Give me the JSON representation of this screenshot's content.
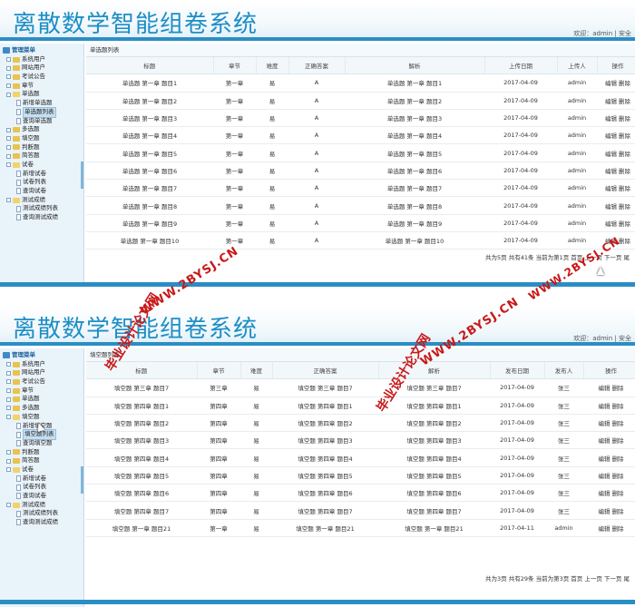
{
  "panel1": {
    "app_title": "离散数学智能组卷系统",
    "welcome": "欢迎：admin | 安全",
    "sidebar": [
      {
        "label": "管理菜单",
        "level": 0,
        "kind": "root"
      },
      {
        "label": "系统用户",
        "level": 1,
        "kind": "folder"
      },
      {
        "label": "网站用户",
        "level": 1,
        "kind": "folder"
      },
      {
        "label": "考试公告",
        "level": 1,
        "kind": "folder"
      },
      {
        "label": "章节",
        "level": 1,
        "kind": "folder"
      },
      {
        "label": "单选题",
        "level": 1,
        "kind": "folder-open"
      },
      {
        "label": "新增单选题",
        "level": 2,
        "kind": "page"
      },
      {
        "label": "单选题列表",
        "level": 2,
        "kind": "page",
        "selected": true
      },
      {
        "label": "查询单选题",
        "level": 2,
        "kind": "page"
      },
      {
        "label": "多选题",
        "level": 1,
        "kind": "folder"
      },
      {
        "label": "填空题",
        "level": 1,
        "kind": "folder"
      },
      {
        "label": "判断题",
        "level": 1,
        "kind": "folder"
      },
      {
        "label": "简答题",
        "level": 1,
        "kind": "folder"
      },
      {
        "label": "试卷",
        "level": 1,
        "kind": "folder-open"
      },
      {
        "label": "新增试卷",
        "level": 2,
        "kind": "page"
      },
      {
        "label": "试卷列表",
        "level": 2,
        "kind": "page"
      },
      {
        "label": "查询试卷",
        "level": 2,
        "kind": "page"
      },
      {
        "label": "测试成绩",
        "level": 1,
        "kind": "folder-open"
      },
      {
        "label": "测试成绩列表",
        "level": 2,
        "kind": "page"
      },
      {
        "label": "查询测试成绩",
        "level": 2,
        "kind": "page"
      }
    ],
    "list_title": "单选题列表",
    "columns": [
      "标题",
      "章节",
      "难度",
      "正确答案",
      "解析",
      "上传日期",
      "上传人",
      "操作"
    ],
    "rows": [
      [
        "单选题 第一章 题目1",
        "第一章",
        "易",
        "A",
        "单选题 第一章 题目1",
        "2017-04-09",
        "admin"
      ],
      [
        "单选题 第一章 题目2",
        "第一章",
        "易",
        "A",
        "单选题 第一章 题目2",
        "2017-04-09",
        "admin"
      ],
      [
        "单选题 第一章 题目3",
        "第一章",
        "易",
        "A",
        "单选题 第一章 题目3",
        "2017-04-09",
        "admin"
      ],
      [
        "单选题 第一章 题目4",
        "第一章",
        "易",
        "A",
        "单选题 第一章 题目4",
        "2017-04-09",
        "admin"
      ],
      [
        "单选题 第一章 题目5",
        "第一章",
        "易",
        "A",
        "单选题 第一章 题目5",
        "2017-04-09",
        "admin"
      ],
      [
        "单选题 第一章 题目6",
        "第一章",
        "易",
        "A",
        "单选题 第一章 题目6",
        "2017-04-09",
        "admin"
      ],
      [
        "单选题 第一章 题目7",
        "第一章",
        "易",
        "A",
        "单选题 第一章 题目7",
        "2017-04-09",
        "admin"
      ],
      [
        "单选题 第一章 题目8",
        "第一章",
        "易",
        "A",
        "单选题 第一章 题目8",
        "2017-04-09",
        "admin"
      ],
      [
        "单选题 第一章 题目9",
        "第一章",
        "易",
        "A",
        "单选题 第一章 题目9",
        "2017-04-09",
        "admin"
      ],
      [
        "单选题 第一章 题目10",
        "第一章",
        "易",
        "A",
        "单选题 第一章 题目10",
        "2017-04-09",
        "admin"
      ]
    ],
    "ops": [
      "编辑",
      "删除"
    ],
    "pagination": "共为5页 共有41条 当前为第1页 首页 上一页 下一页 尾"
  },
  "panel2": {
    "app_title": "离散数学智能组卷系统",
    "welcome": "欢迎：admin | 安全",
    "sidebar": [
      {
        "label": "管理菜单",
        "level": 0,
        "kind": "root"
      },
      {
        "label": "系统用户",
        "level": 1,
        "kind": "folder"
      },
      {
        "label": "网站用户",
        "level": 1,
        "kind": "folder"
      },
      {
        "label": "考试公告",
        "level": 1,
        "kind": "folder"
      },
      {
        "label": "章节",
        "level": 1,
        "kind": "folder"
      },
      {
        "label": "单选题",
        "level": 1,
        "kind": "folder"
      },
      {
        "label": "多选题",
        "level": 1,
        "kind": "folder"
      },
      {
        "label": "填空题",
        "level": 1,
        "kind": "folder-open"
      },
      {
        "label": "新增填空题",
        "level": 2,
        "kind": "page"
      },
      {
        "label": "填空题列表",
        "level": 2,
        "kind": "page",
        "selected": true
      },
      {
        "label": "查询填空题",
        "level": 2,
        "kind": "page"
      },
      {
        "label": "判断题",
        "level": 1,
        "kind": "folder"
      },
      {
        "label": "简答题",
        "level": 1,
        "kind": "folder"
      },
      {
        "label": "试卷",
        "level": 1,
        "kind": "folder-open"
      },
      {
        "label": "新增试卷",
        "level": 2,
        "kind": "page"
      },
      {
        "label": "试卷列表",
        "level": 2,
        "kind": "page"
      },
      {
        "label": "查询试卷",
        "level": 2,
        "kind": "page"
      },
      {
        "label": "测试成绩",
        "level": 1,
        "kind": "folder-open"
      },
      {
        "label": "测试成绩列表",
        "level": 2,
        "kind": "page"
      },
      {
        "label": "查询测试成绩",
        "level": 2,
        "kind": "page"
      }
    ],
    "list_title": "填空题列表",
    "columns": [
      "标题",
      "章节",
      "难度",
      "正确答案",
      "解析",
      "发布日期",
      "发布人",
      "操作"
    ],
    "rows": [
      [
        "填空题 第三章 题目7",
        "第三章",
        "易",
        "填空题 第三章 题目7",
        "填空题 第三章 题目7",
        "2017-04-09",
        "张三"
      ],
      [
        "填空题 第四章 题目1",
        "第四章",
        "易",
        "填空题 第四章 题目1",
        "填空题 第四章 题目1",
        "2017-04-09",
        "张三"
      ],
      [
        "填空题 第四章 题目2",
        "第四章",
        "易",
        "填空题 第四章 题目2",
        "填空题 第四章 题目2",
        "2017-04-09",
        "张三"
      ],
      [
        "填空题 第四章 题目3",
        "第四章",
        "易",
        "填空题 第四章 题目3",
        "填空题 第四章 题目3",
        "2017-04-09",
        "张三"
      ],
      [
        "填空题 第四章 题目4",
        "第四章",
        "易",
        "填空题 第四章 题目4",
        "填空题 第四章 题目4",
        "2017-04-09",
        "张三"
      ],
      [
        "填空题 第四章 题目5",
        "第四章",
        "易",
        "填空题 第四章 题目5",
        "填空题 第四章 题目5",
        "2017-04-09",
        "张三"
      ],
      [
        "填空题 第四章 题目6",
        "第四章",
        "易",
        "填空题 第四章 题目6",
        "填空题 第四章 题目6",
        "2017-04-09",
        "张三"
      ],
      [
        "填空题 第四章 题目7",
        "第四章",
        "易",
        "填空题 第四章 题目7",
        "填空题 第四章 题目7",
        "2017-04-09",
        "张三"
      ],
      [
        "填空题 第一章 题目21",
        "第一章",
        "易",
        "填空题 第一章 题目21",
        "填空题 第一章 题目21",
        "2017-04-11",
        "admin"
      ]
    ],
    "ops": [
      "编辑",
      "删除"
    ],
    "pagination": "共为3页 共有29条 当前为第3页 首页 上一页 下一页 尾"
  },
  "watermarks": [
    {
      "text": "WWW.2BYSJ.CN"
    },
    {
      "text": "毕业设计论文网"
    },
    {
      "text": "WWW.2BYSJ.CN"
    },
    {
      "text": "毕业设计论文网"
    },
    {
      "text": "WWW.2BYSJ.CN"
    }
  ],
  "colors": {
    "accent": "#2a8ec4",
    "title": "#1d8ec6",
    "watermark": "#c81818"
  },
  "icons": [
    "folder-icon",
    "page-icon",
    "tree-toggle-icon",
    "mouse-cursor-icon"
  ]
}
